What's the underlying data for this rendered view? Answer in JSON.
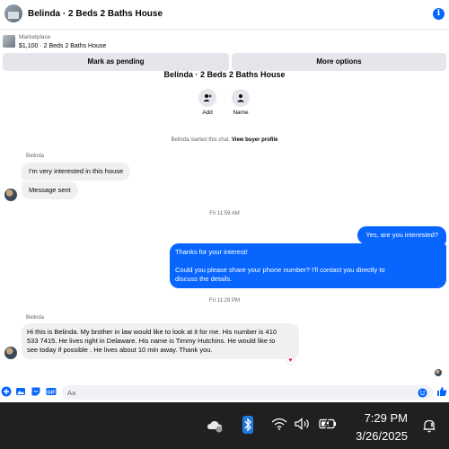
{
  "header": {
    "title": "Belinda · 2 Beds 2 Baths House",
    "info_icon": "i"
  },
  "listing": {
    "category": "Marketplace",
    "price_title": "$1,100 · 2 Beds 2 Baths House"
  },
  "actions": {
    "mark_pending": "Mark as pending",
    "more_options": "More options"
  },
  "chat_header": {
    "title": "Belinda · 2 Beds 2 Baths House",
    "add_label": "Add",
    "name_label": "Name",
    "started_text": "Belinda started this chat. ",
    "view_profile": "View buyer profile"
  },
  "messages": {
    "sender1": "Belinda",
    "m1": "I'm very interested in this house",
    "m2": "Message sent",
    "ts1": "Fri 11:59 AM",
    "out1": "Yes, are you interested?",
    "out2_line1": "Thanks for your interest!",
    "out2_line2": "Could you please share your phone number? I'll contact you directly to",
    "out2_line3": "discuss the details.",
    "ts2": "Fri 11:29 PM",
    "sender2": "Belinda",
    "m3_line1": "Hi this is Belinda. My brother in law would like to look at it for  me. His number is 410",
    "m3_line2": "533 7415. He lives right in Delaware. His name is Timmy Hutchins.  He would like to",
    "m3_line3": "see today if possible . He lives about 10 min away. Thank you.",
    "reaction": "♥"
  },
  "composer": {
    "placeholder": "Aa"
  },
  "taskbar": {
    "time": "7:29 PM",
    "date": "3/26/2025"
  },
  "colors": {
    "accent": "#0866ff",
    "bubble_in": "#f0f0f0",
    "taskbar": "#202020"
  }
}
